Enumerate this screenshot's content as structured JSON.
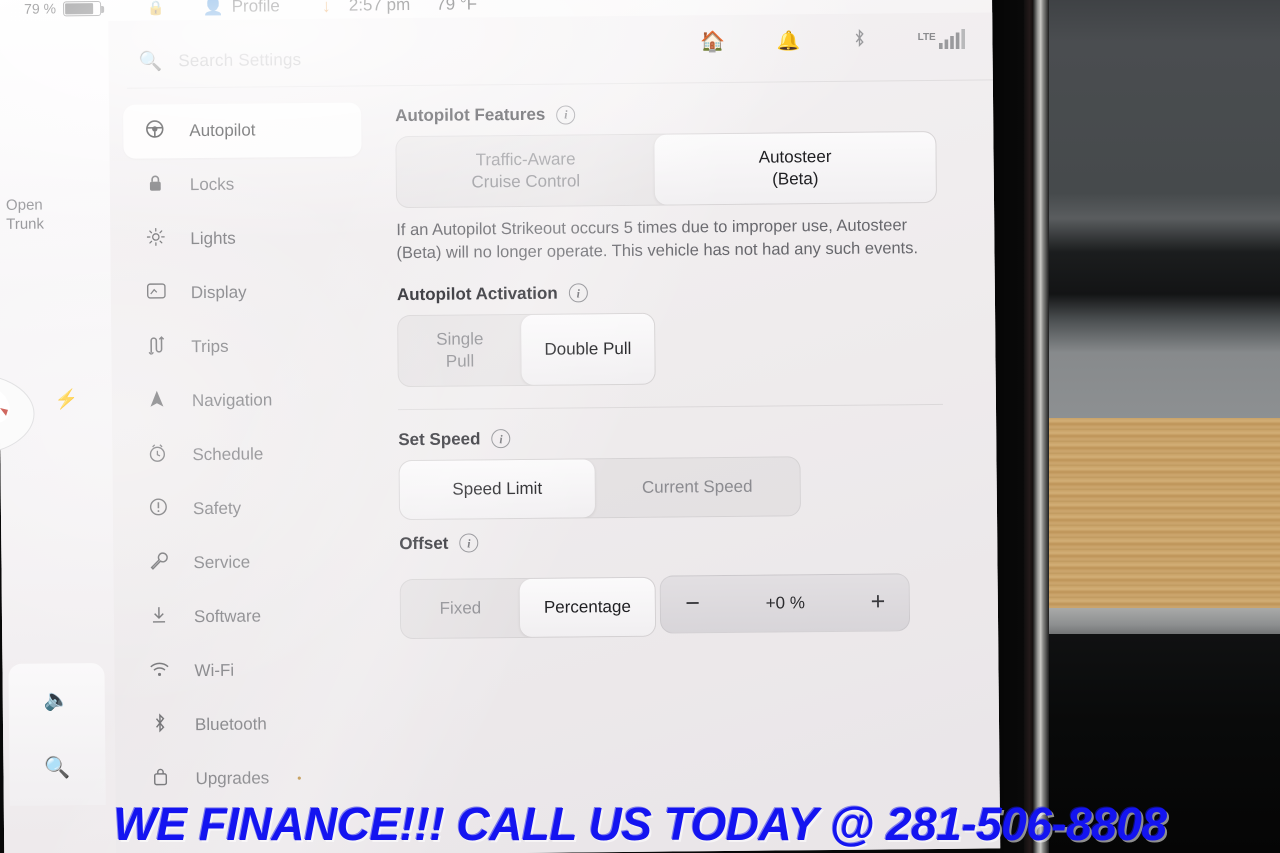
{
  "status_bar": {
    "battery_percent": "79 %",
    "lock_icon": "lock-icon",
    "profile_label": "Profile",
    "profile_icon": "person-icon",
    "download_icon": "download-arrow-icon",
    "time": "2:57 pm",
    "temperature": "79 °F",
    "garage_icon": "garage-icon",
    "bell_icon": "bell-icon",
    "bluetooth_icon": "bluetooth-icon",
    "signal_label": "LTE",
    "signal_icon": "cellular-bars-icon"
  },
  "left_rail": {
    "open_trunk_label": "Open\nTrunk",
    "open_trunk_line1": "Open",
    "open_trunk_line2": "Trunk",
    "charge_icon": "charge-bolt-icon",
    "volume_icon": "volume-mute-icon",
    "search_icon": "search-icon"
  },
  "search": {
    "placeholder": "Search Settings",
    "icon": "search-icon"
  },
  "sidebar": {
    "items": [
      {
        "label": "Autopilot",
        "icon": "steering-wheel-icon",
        "glyph": "⊕",
        "selected": true
      },
      {
        "label": "Locks",
        "icon": "lock-icon",
        "glyph": "🔒",
        "selected": false
      },
      {
        "label": "Lights",
        "icon": "sun-icon",
        "glyph": "☼",
        "selected": false
      },
      {
        "label": "Display",
        "icon": "display-icon",
        "glyph": "▣",
        "selected": false
      },
      {
        "label": "Trips",
        "icon": "trips-route-icon",
        "glyph": "⌇",
        "selected": false
      },
      {
        "label": "Navigation",
        "icon": "navigation-arrow-icon",
        "glyph": "▲",
        "selected": false
      },
      {
        "label": "Schedule",
        "icon": "clock-icon",
        "glyph": "⏱",
        "selected": false
      },
      {
        "label": "Safety",
        "icon": "exclamation-circle-icon",
        "glyph": "ⓘ",
        "selected": false
      },
      {
        "label": "Service",
        "icon": "wrench-icon",
        "glyph": "🔧",
        "selected": false
      },
      {
        "label": "Software",
        "icon": "download-icon",
        "glyph": "⤓",
        "selected": false
      },
      {
        "label": "Wi-Fi",
        "icon": "wifi-icon",
        "glyph": "◠",
        "selected": false
      },
      {
        "label": "Bluetooth",
        "icon": "bluetooth-icon",
        "glyph": "ᛦ",
        "selected": false
      },
      {
        "label": "Upgrades",
        "icon": "bag-icon",
        "glyph": "□",
        "selected": false,
        "badge": "•"
      }
    ]
  },
  "main": {
    "sections": [
      {
        "title": "Autopilot Features",
        "info_icon": "info-icon",
        "options": [
          {
            "label": "Traffic-Aware\nCruise Control",
            "line1": "Traffic-Aware",
            "line2": "Cruise Control",
            "selected": false
          },
          {
            "label": "Autosteer\n(Beta)",
            "line1": "Autosteer",
            "line2": "(Beta)",
            "selected": true
          }
        ],
        "note": "If an Autopilot Strikeout occurs 5 times due to improper use, Autosteer (Beta) will no longer operate. This vehicle has not had any such events."
      },
      {
        "title": "Autopilot Activation",
        "info_icon": "info-icon",
        "options": [
          {
            "label": "Single Pull",
            "line1": "Single Pull",
            "line2": "",
            "selected": false
          },
          {
            "label": "Double Pull",
            "line1": "Double Pull",
            "line2": "",
            "selected": true
          }
        ],
        "note": ""
      },
      {
        "title": "Set Speed",
        "info_icon": "info-icon",
        "options": [
          {
            "label": "Speed Limit",
            "line1": "Speed Limit",
            "line2": "",
            "selected": true
          },
          {
            "label": "Current Speed",
            "line1": "Current Speed",
            "line2": "",
            "selected": false
          }
        ],
        "note": ""
      },
      {
        "title": "Offset",
        "info_icon": "info-icon",
        "options": [
          {
            "label": "Fixed",
            "line1": "Fixed",
            "line2": "",
            "selected": false
          },
          {
            "label": "Percentage",
            "line1": "Percentage",
            "line2": "",
            "selected": true
          }
        ],
        "note": ""
      }
    ],
    "offset_stepper": {
      "decrease_label": "−",
      "value": "+0 %",
      "increase_label": "+"
    }
  },
  "watermark": {
    "text": "WE FINANCE!!! CALL US TODAY @ 281-506-8808",
    "color": "#1414f0"
  }
}
